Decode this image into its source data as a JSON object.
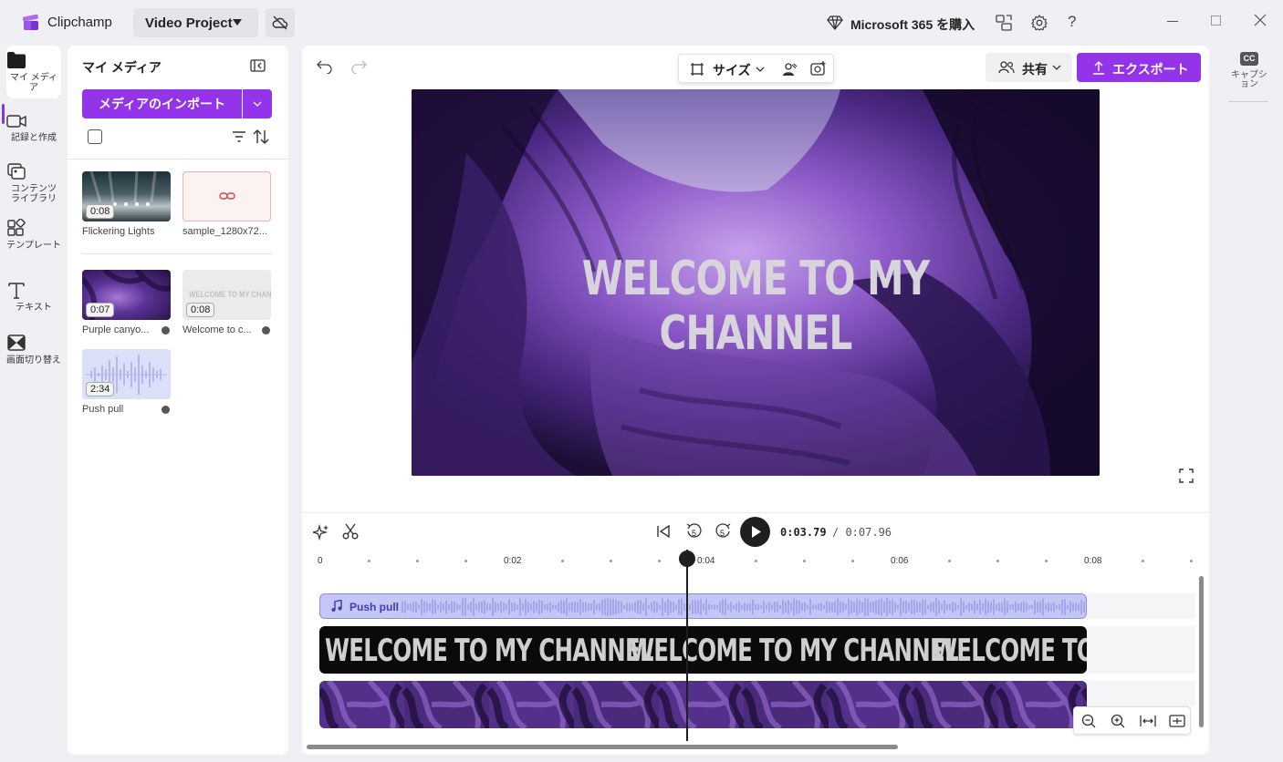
{
  "titlebar": {
    "app_name": "Clipchamp",
    "project_name": "Video Project",
    "ms365_label": "Microsoft 365 を購入"
  },
  "rail": {
    "items": [
      {
        "label": "マイ メディア",
        "icon": "folder-icon",
        "active": true
      },
      {
        "label": "記録と作成",
        "icon": "camera-icon"
      },
      {
        "label": "コンテンツ ライブラリ",
        "icon": "library-icon"
      },
      {
        "label": "テンプレート",
        "icon": "template-icon"
      },
      {
        "label": "テキスト",
        "icon": "text-icon"
      },
      {
        "label": "画面切り替え",
        "icon": "transition-icon"
      }
    ]
  },
  "media": {
    "title": "マイ メディア",
    "import_label": "メディアのインポート",
    "items": [
      {
        "name": "Flickering Lights",
        "duration": "0:08",
        "kind": "video"
      },
      {
        "name": "sample_1280x72...",
        "duration": "",
        "kind": "link"
      },
      {
        "name": "Purple canyo...",
        "duration": "0:07",
        "kind": "video",
        "used": true
      },
      {
        "name": "Welcome to c...",
        "duration": "0:08",
        "kind": "title",
        "used": true
      },
      {
        "name": "Push pull",
        "duration": "2:34",
        "kind": "audio",
        "used": true
      }
    ],
    "thumb_text": "WELCOME TO MY CHANNEL"
  },
  "toolbar": {
    "size_label": "サイズ",
    "share_label": "共有",
    "export_label": "エクスポート"
  },
  "preview": {
    "overlay_text": "WELCOME TO MY CHANNEL"
  },
  "playback": {
    "current_time": "0:03.79",
    "total_time": "/ 0:07.96",
    "skip_back_seconds": "5",
    "skip_fwd_seconds": "5"
  },
  "timeline": {
    "ticks": [
      "0",
      "0:02",
      "0:04",
      "0:06",
      "0:08"
    ],
    "audio_clip_label": "Push pull",
    "title_clip_text": "WELCOME TO MY CHANNEL",
    "playhead_time": 3.79
  },
  "captions": {
    "label": "キャプション",
    "badge": "CC"
  },
  "colors": {
    "accent": "#9333ea",
    "audio_clip": "#c4c6f5",
    "title_clip": "#0a0a0a"
  }
}
